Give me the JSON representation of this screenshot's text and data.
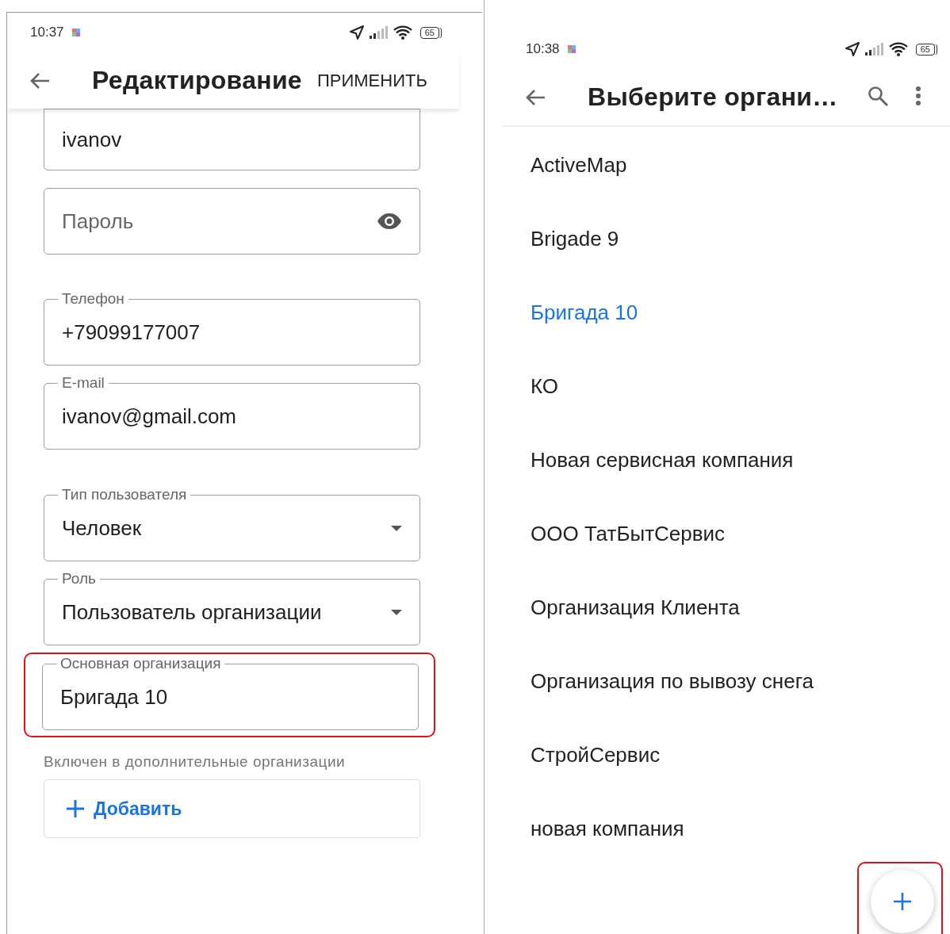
{
  "edit_screen": {
    "status_bar": {
      "time": "10:37",
      "battery": "65"
    },
    "app_bar": {
      "title": "Редактирование",
      "action": "ПРИМЕНИТЬ"
    },
    "fields": [
      {
        "kind": "text",
        "value": "ivanov",
        "highlighted": false
      },
      {
        "kind": "password",
        "placeholder": "Пароль",
        "highlighted": false
      },
      {
        "kind": "text",
        "label": "Телефон",
        "value": "+79099177007",
        "highlighted": false
      },
      {
        "kind": "text",
        "label": "E-mail",
        "value": "ivanov@gmail.com",
        "highlighted": false
      },
      {
        "kind": "select",
        "label": "Тип пользователя",
        "value": "Человек",
        "highlighted": false
      },
      {
        "kind": "select",
        "label": "Роль",
        "value": "Пользователь организации",
        "highlighted": false
      },
      {
        "kind": "text",
        "label": "Основная организация",
        "value": "Бригада 10",
        "highlighted": true
      }
    ],
    "section_label": "Включен в дополнительные организации",
    "add_button": "Добавить"
  },
  "select_screen": {
    "status_bar": {
      "time": "10:38",
      "battery": "65"
    },
    "app_bar": {
      "title": "Выберите органи…"
    },
    "items": [
      {
        "label": "ActiveMap",
        "selected": false
      },
      {
        "label": "Brigade 9",
        "selected": false
      },
      {
        "label": "Бригада 10",
        "selected": true
      },
      {
        "label": "КО",
        "selected": false
      },
      {
        "label": "Новая сервисная компания",
        "selected": false
      },
      {
        "label": "ООО ТатБытСервис",
        "selected": false
      },
      {
        "label": "Организация Клиента",
        "selected": false
      },
      {
        "label": "Организация по вывозу снега",
        "selected": false
      },
      {
        "label": "СтройСервис",
        "selected": false
      },
      {
        "label": "новая компания",
        "selected": false
      }
    ],
    "fab": {
      "highlighted": true
    }
  }
}
